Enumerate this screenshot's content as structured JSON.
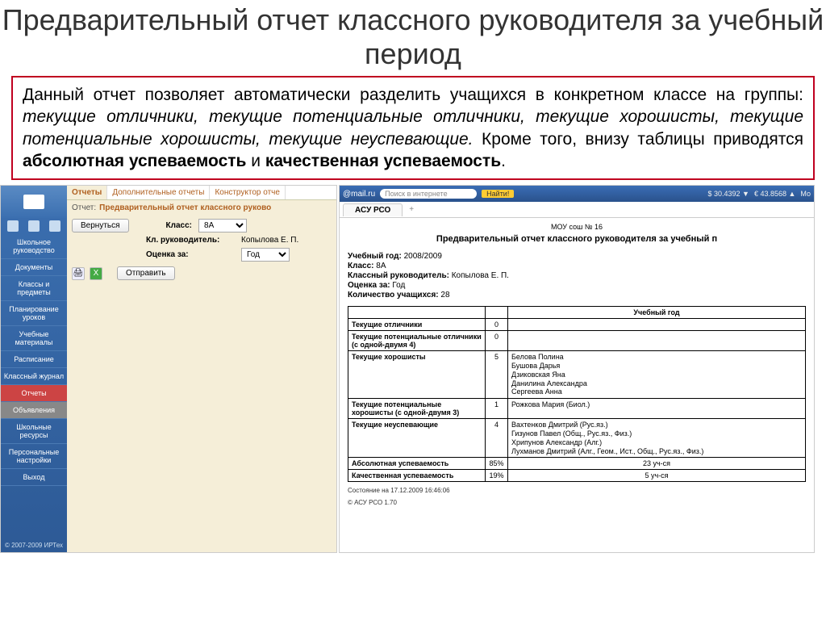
{
  "slide": {
    "title": "Предварительный отчет классного руководителя за учебный период",
    "desc_p1": "Данный отчет позволяет автоматически разделить учащихся в конкретном классе на группы: ",
    "desc_i": "текущие отличники, текущие потенциальные отличники, текущие хорошисты, текущие потенциальные хорошисты, текущие неуспевающие.",
    "desc_p2": " Кроме того, внизу таблицы приводятся ",
    "desc_b1": "абсолютная успеваемость",
    "desc_p3": " и ",
    "desc_b2": "качественная успеваемость",
    "desc_p4": "."
  },
  "nav": {
    "items": [
      "Школьное руководство",
      "Документы",
      "Классы и предметы",
      "Планирование уроков",
      "Учебные материалы",
      "Расписание",
      "Классный журнал",
      "Отчеты",
      "Объявления",
      "Школьные ресурсы",
      "Персональные настройки",
      "Выход"
    ],
    "footer": "© 2007-2009 ИРТех"
  },
  "tabs": [
    "Отчеты",
    "Дополнительные отчеты",
    "Конструктор отче"
  ],
  "report": {
    "label": "Отчет:",
    "name": "Предварительный отчет классного руково"
  },
  "controls": {
    "back": "Вернуться",
    "class_lbl": "Класс:",
    "class_val": "8А",
    "teacher_lbl": "Кл. руководитель:",
    "teacher_val": "Копылова Е. П.",
    "grade_lbl": "Оценка за:",
    "grade_val": "Год",
    "send": "Отправить"
  },
  "rtop": {
    "brand": "@mail.ru",
    "search_ph": "Поиск в интернете",
    "go": "Найти!",
    "rate1": "$ 30.4392 ▼",
    "rate2": "€ 43.8568 ▲",
    "end": "Мо"
  },
  "doc": {
    "tab": "АСУ РСО",
    "org": "МОУ сош № 16",
    "title": "Предварительный отчет классного руководителя за учебный п",
    "meta": {
      "year_l": "Учебный год:",
      "year_v": " 2008/2009",
      "class_l": "Класс:",
      "class_v": " 8А",
      "teacher_l": "Классный руководитель:",
      "teacher_v": " Копылова Е. П.",
      "grade_l": "Оценка за:",
      "grade_v": " Год",
      "count_l": "Количество учащихся:",
      "count_v": " 28"
    },
    "table": {
      "header": "Учебный год",
      "rows": [
        {
          "label": "Текущие отличники",
          "n": "0",
          "names": []
        },
        {
          "label": "Текущие потенциальные отличники (с одной-двумя 4)",
          "n": "0",
          "names": []
        },
        {
          "label": "Текущие хорошисты",
          "n": "5",
          "names": [
            "Белова Полина",
            "Бушова Дарья",
            "Дзиковская Яна",
            "Данилина Александра",
            "Сергеева Анна"
          ]
        },
        {
          "label": "Текущие потенциальные хорошисты (с одной-двумя 3)",
          "n": "1",
          "names": [
            "Рожкова Мария (Биол.)"
          ]
        },
        {
          "label": "Текущие неуспевающие",
          "n": "4",
          "names": [
            "Вахтенков Дмитрий (Рус.яз.)",
            "Гизунов Павел (Общ., Рус.яз., Физ.)",
            "Хрипунов Александр (Алг.)",
            "Лухманов Дмитрий (Алг., Геом., Ист., Общ., Рус.яз., Физ.)"
          ]
        }
      ],
      "abs_l": "Абсолютная успеваемость",
      "abs_p": "85%",
      "abs_t": "23 уч-ся",
      "qual_l": "Качественная успеваемость",
      "qual_p": "19%",
      "qual_t": "5 уч-ся"
    },
    "foot1": "Состояние на 17.12.2009 16:46:06",
    "foot2": "© АСУ РСО 1.70"
  }
}
